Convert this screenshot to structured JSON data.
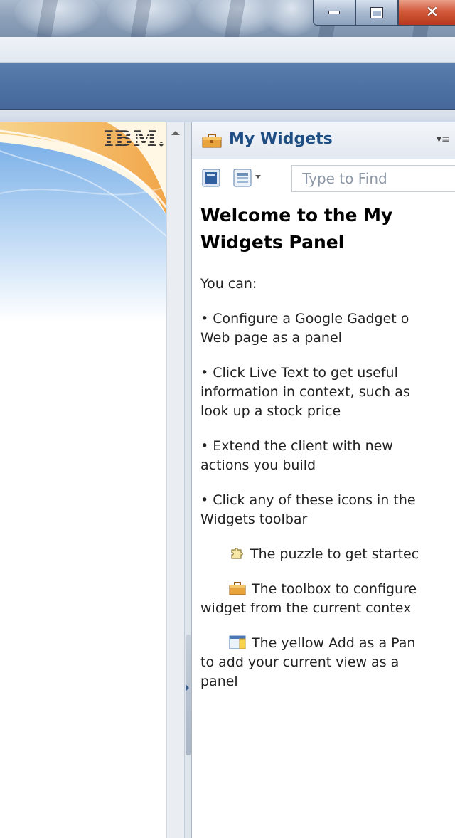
{
  "window": {
    "controls": {
      "minimize": "minimize-icon",
      "maximize": "maximize-icon",
      "close": "close-icon"
    }
  },
  "home": {
    "logo_text": "IBM."
  },
  "widgets_panel": {
    "title": "My Widgets",
    "title_icon": "toolbox-icon",
    "menu_icon": "panel-menu-icon",
    "toolbar": {
      "button_1_icon": "widget-icon",
      "button_2_icon": "view-options-icon",
      "dropdown_icon": "chevron-down-icon",
      "find_placeholder": "Type to Find"
    },
    "content": {
      "heading": "Welcome to the My Widgets Panel",
      "intro": "You can:",
      "bullet_1_line_1": "• Configure a Google Gadget o",
      "bullet_1_line_2": "Web page as a panel",
      "bullet_2_line_1": "• Click Live Text to get useful",
      "bullet_2_line_2": "information in context, such as",
      "bullet_2_line_3": "look up a stock price",
      "bullet_3_line_1": "• Extend the client with new",
      "bullet_3_line_2": "actions you build",
      "bullet_4_line_1": "• Click any of these icons in the",
      "bullet_4_line_2": "Widgets toolbar",
      "puzzle_text": "The puzzle to get startec",
      "toolbox_line_1": "The toolbox to configure",
      "toolbox_line_2": "widget from the current contex",
      "addpanel_line_1": "The yellow Add as a Pan",
      "addpanel_line_2": "to add your current view as a",
      "addpanel_line_3": "panel",
      "icons": {
        "puzzle": "puzzle-icon",
        "toolbox": "toolbox-icon",
        "add_panel": "add-as-panel-icon"
      }
    }
  },
  "colors": {
    "title_blue": "#1f4e85",
    "bar_blue": "#4d72a3",
    "banner_orange": "#f2a64a"
  }
}
